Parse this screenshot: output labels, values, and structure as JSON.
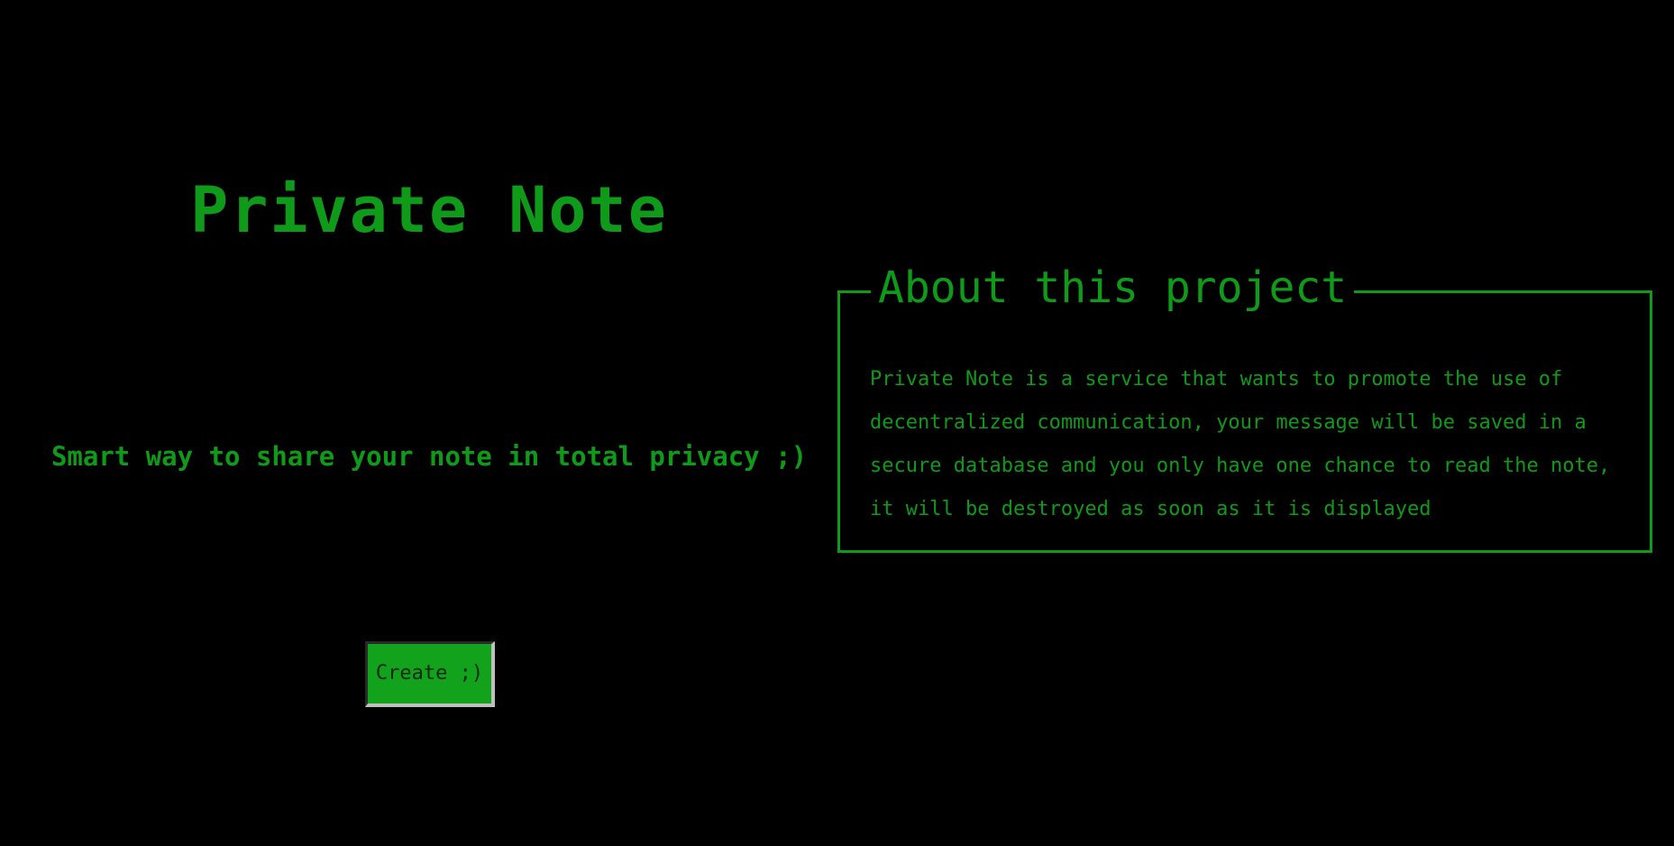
{
  "header": {
    "title": "Private Note"
  },
  "main": {
    "tagline": "Smart way to share your note in total privacy ;)",
    "create_button_label": "Create ;)"
  },
  "about": {
    "heading": "About this project",
    "description": "Private Note is a service that wants to promote the use of decentralized communication, your message will be saved in a secure database and you only have one chance to read the note, it will be destroyed as soon as it is displayed"
  },
  "colors": {
    "background": "#000000",
    "accent": "#0f9a1a",
    "button_fill": "#12a21c"
  }
}
